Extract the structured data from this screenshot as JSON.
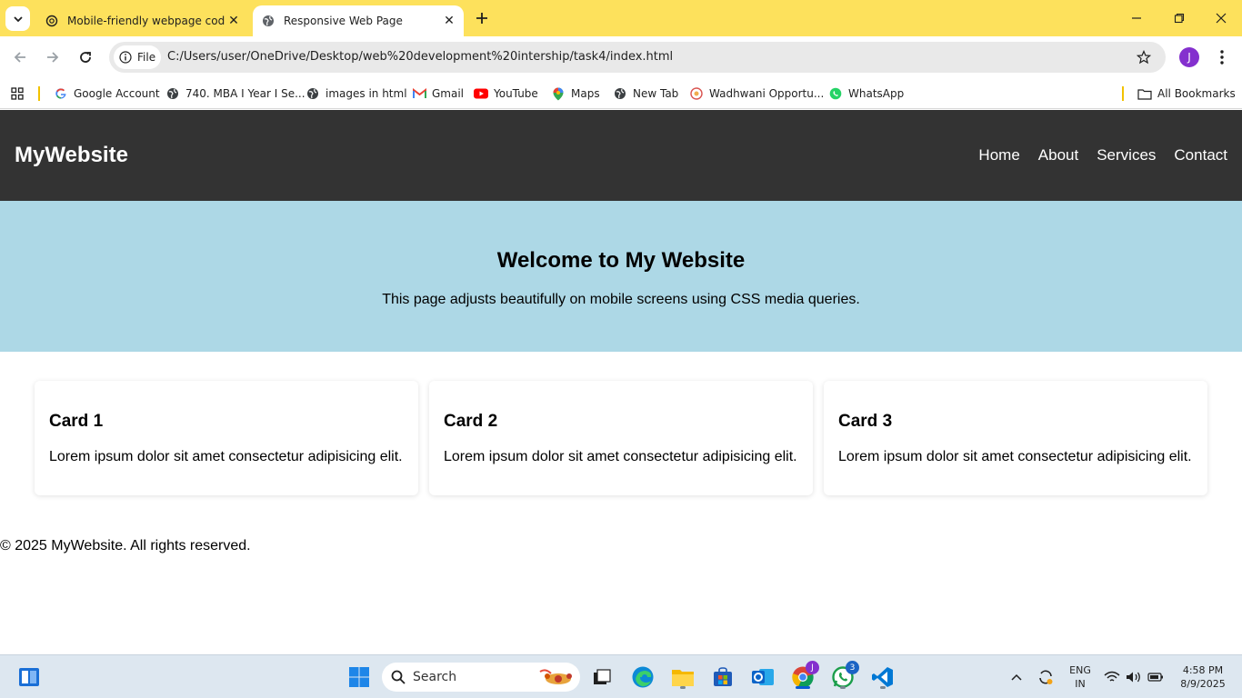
{
  "browser": {
    "tabs": [
      {
        "title": "Mobile-friendly webpage code",
        "active": false,
        "icon": "chatgpt-icon"
      },
      {
        "title": "Responsive Web Page",
        "active": true,
        "icon": "globe-icon"
      }
    ],
    "chip_label": "File",
    "url": "C:/Users/user/OneDrive/Desktop/web%20development%20intership/task4/index.html",
    "profile_initial": "J",
    "bookmarks": [
      {
        "label": "Google Account",
        "icon": "google-icon"
      },
      {
        "label": "740. MBA I Year I Se...",
        "icon": "globe-icon"
      },
      {
        "label": "images in html",
        "icon": "globe-icon"
      },
      {
        "label": "Gmail",
        "icon": "gmail-icon"
      },
      {
        "label": "YouTube",
        "icon": "youtube-icon"
      },
      {
        "label": "Maps",
        "icon": "maps-icon"
      },
      {
        "label": "New Tab",
        "icon": "globe-icon"
      },
      {
        "label": "Wadhwani Opportu...",
        "icon": "wadhwani-icon"
      },
      {
        "label": "WhatsApp",
        "icon": "whatsapp-icon"
      }
    ],
    "all_bookmarks": "All Bookmarks",
    "theme_color": "#fde15c"
  },
  "site": {
    "logo": "MyWebsite",
    "nav": [
      "Home",
      "About",
      "Services",
      "Contact"
    ],
    "hero_title": "Welcome to My Website",
    "hero_text": "This page adjusts beautifully on mobile screens using CSS media queries.",
    "cards": [
      {
        "title": "Card 1",
        "text": "Lorem ipsum dolor sit amet consectetur adipisicing elit."
      },
      {
        "title": "Card 2",
        "text": "Lorem ipsum dolor sit amet consectetur adipisicing elit."
      },
      {
        "title": "Card 3",
        "text": "Lorem ipsum dolor sit amet consectetur adipisicing elit."
      }
    ],
    "footer": "© 2025 MyWebsite. All rights reserved.",
    "header_color": "#333333",
    "hero_color": "#add8e6"
  },
  "taskbar": {
    "search_placeholder": "Search",
    "whatsapp_badge": "3",
    "chrome_profile_badge": "J",
    "language_line1": "ENG",
    "language_line2": "IN",
    "time": "4:58 PM",
    "date": "8/9/2025"
  }
}
